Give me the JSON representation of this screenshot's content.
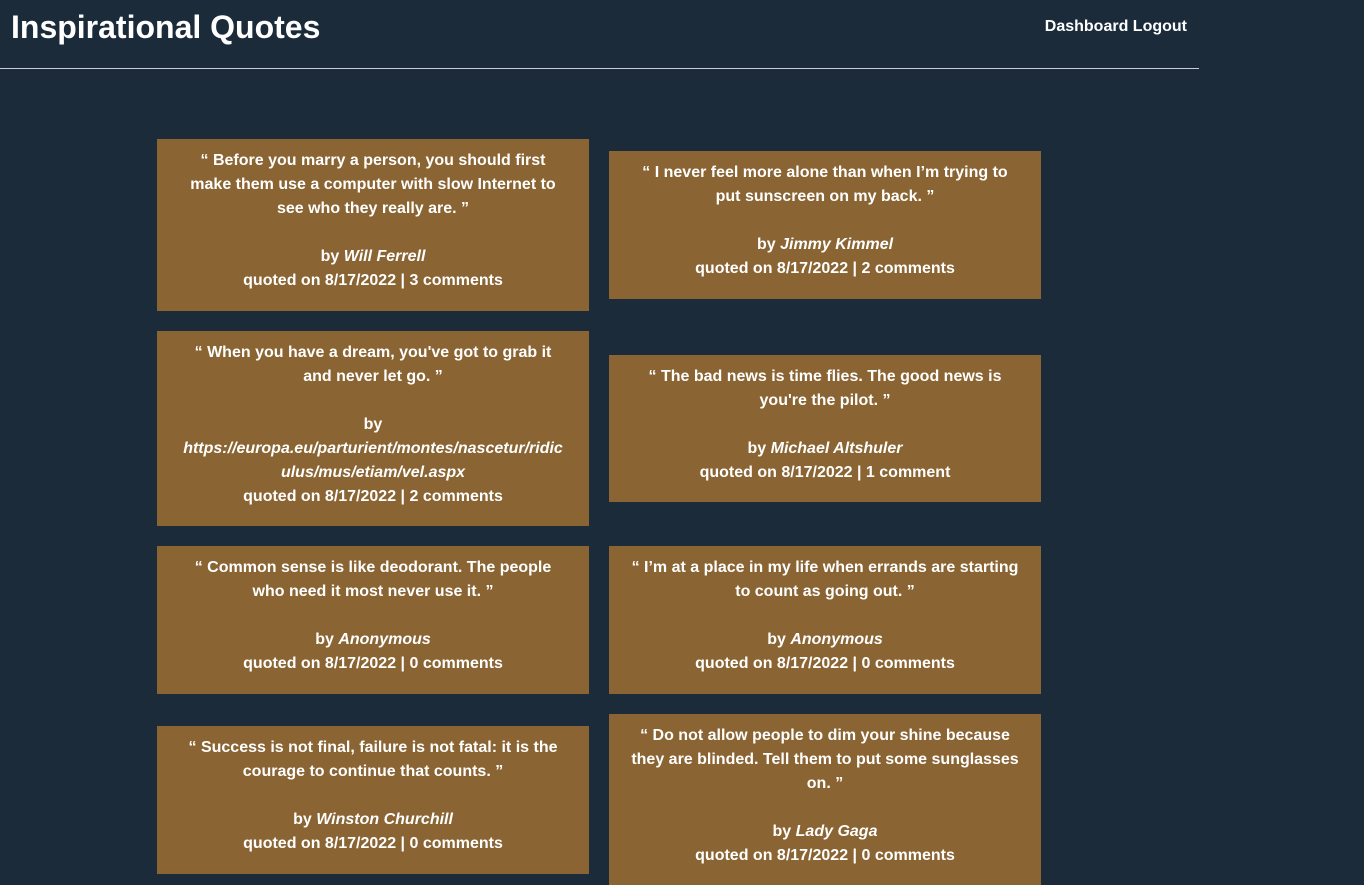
{
  "header": {
    "title": "Inspirational Quotes",
    "nav": {
      "dashboard": "Dashboard",
      "logout": "Logout"
    }
  },
  "colors": {
    "background": "#1b2b3a",
    "card": "#8a6433",
    "text": "#ffffff"
  },
  "quotes": [
    {
      "text": "“ Before you marry a person, you should first make them use a computer with slow Internet to see who they really are. ”",
      "by": "by",
      "author": "Will Ferrell",
      "quoted": "quoted on 8/17/2022 |",
      "comments": "3 comments"
    },
    {
      "text": "“ I never feel more alone than when I’m trying to put sunscreen on my back. ”",
      "by": "by",
      "author": "Jimmy Kimmel",
      "quoted": "quoted on 8/17/2022 |",
      "comments": "2 comments"
    },
    {
      "text": "“ When you have a dream, you've got to grab it and never let go. ”",
      "by": "by",
      "author": "https://europa.eu/parturient/montes/nascetur/ridiculus/mus/etiam/vel.aspx",
      "quoted": "quoted on 8/17/2022 |",
      "comments": "2 comments"
    },
    {
      "text": "“ The bad news is time flies. The good news is you're the pilot. ”",
      "by": "by",
      "author": "Michael Altshuler",
      "quoted": "quoted on 8/17/2022 |",
      "comments": "1 comment"
    },
    {
      "text": "“ Common sense is like deodorant. The people who need it most never use it. ”",
      "by": "by",
      "author": "Anonymous",
      "quoted": "quoted on 8/17/2022 |",
      "comments": "0 comments"
    },
    {
      "text": "“ I’m at a place in my life when errands are starting to count as going out. ”",
      "by": "by",
      "author": "Anonymous",
      "quoted": "quoted on 8/17/2022 |",
      "comments": "0 comments"
    },
    {
      "text": "“ Success is not final, failure is not fatal: it is the courage to continue that counts. ”",
      "by": "by",
      "author": "Winston Churchill",
      "quoted": "quoted on 8/17/2022 |",
      "comments": "0 comments"
    },
    {
      "text": "“ Do not allow people to dim your shine because they are blinded. Tell them to put some sunglasses on. ”",
      "by": "by",
      "author": "Lady Gaga",
      "quoted": "quoted on 8/17/2022 |",
      "comments": "0 comments"
    }
  ]
}
